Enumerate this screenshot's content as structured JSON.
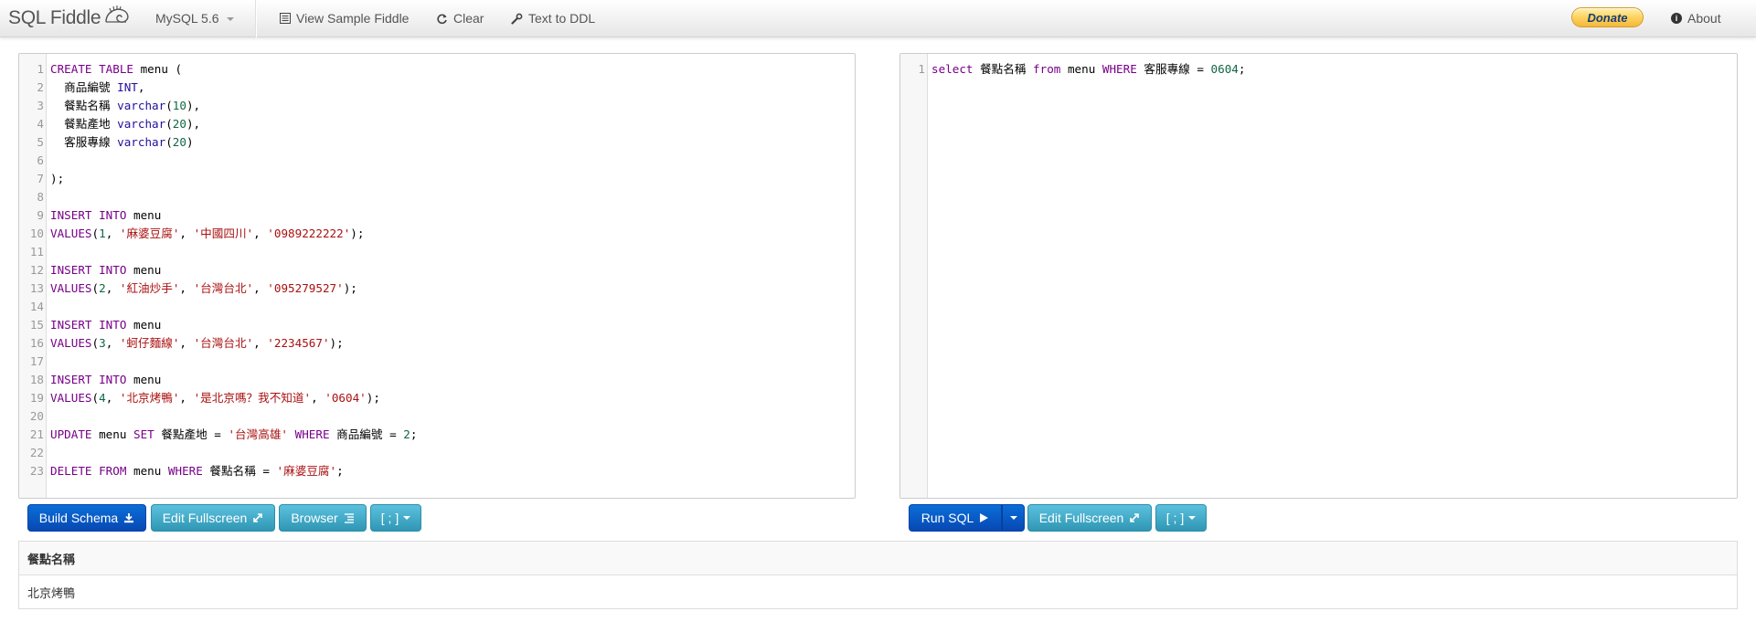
{
  "navbar": {
    "brand": "SQL Fiddle",
    "db_version": "MySQL 5.6",
    "view_sample": "View Sample Fiddle",
    "clear": "Clear",
    "text_to_ddl": "Text to DDL",
    "donate": "Donate",
    "about": "About"
  },
  "schema_editor": {
    "lines": [
      {
        "n": "1",
        "tokens": [
          {
            "t": "CREATE TABLE",
            "c": "kw"
          },
          {
            "t": " menu (",
            "c": ""
          }
        ]
      },
      {
        "n": "2",
        "tokens": [
          {
            "t": "  商品編號 ",
            "c": ""
          },
          {
            "t": "INT",
            "c": "ty"
          },
          {
            "t": ",",
            "c": ""
          }
        ]
      },
      {
        "n": "3",
        "tokens": [
          {
            "t": "  餐點名稱 ",
            "c": ""
          },
          {
            "t": "varchar",
            "c": "ty"
          },
          {
            "t": "(",
            "c": ""
          },
          {
            "t": "10",
            "c": "num"
          },
          {
            "t": "),",
            "c": ""
          }
        ]
      },
      {
        "n": "4",
        "tokens": [
          {
            "t": "  餐點產地 ",
            "c": ""
          },
          {
            "t": "varchar",
            "c": "ty"
          },
          {
            "t": "(",
            "c": ""
          },
          {
            "t": "20",
            "c": "num"
          },
          {
            "t": "),",
            "c": ""
          }
        ]
      },
      {
        "n": "5",
        "tokens": [
          {
            "t": "  客服專線 ",
            "c": ""
          },
          {
            "t": "varchar",
            "c": "ty"
          },
          {
            "t": "(",
            "c": ""
          },
          {
            "t": "20",
            "c": "num"
          },
          {
            "t": ")",
            "c": ""
          }
        ]
      },
      {
        "n": "6",
        "tokens": []
      },
      {
        "n": "7",
        "tokens": [
          {
            "t": ");",
            "c": ""
          }
        ]
      },
      {
        "n": "8",
        "tokens": []
      },
      {
        "n": "9",
        "tokens": [
          {
            "t": "INSERT INTO",
            "c": "kw"
          },
          {
            "t": " menu",
            "c": ""
          }
        ]
      },
      {
        "n": "10",
        "tokens": [
          {
            "t": "VALUES",
            "c": "kw"
          },
          {
            "t": "(",
            "c": ""
          },
          {
            "t": "1",
            "c": "num"
          },
          {
            "t": ", ",
            "c": ""
          },
          {
            "t": "'麻婆豆腐'",
            "c": "str"
          },
          {
            "t": ", ",
            "c": ""
          },
          {
            "t": "'中國四川'",
            "c": "str"
          },
          {
            "t": ", ",
            "c": ""
          },
          {
            "t": "'0989222222'",
            "c": "str"
          },
          {
            "t": ");",
            "c": ""
          }
        ]
      },
      {
        "n": "11",
        "tokens": []
      },
      {
        "n": "12",
        "tokens": [
          {
            "t": "INSERT INTO",
            "c": "kw"
          },
          {
            "t": " menu",
            "c": ""
          }
        ]
      },
      {
        "n": "13",
        "tokens": [
          {
            "t": "VALUES",
            "c": "kw"
          },
          {
            "t": "(",
            "c": ""
          },
          {
            "t": "2",
            "c": "num"
          },
          {
            "t": ", ",
            "c": ""
          },
          {
            "t": "'紅油炒手'",
            "c": "str"
          },
          {
            "t": ", ",
            "c": ""
          },
          {
            "t": "'台灣台北'",
            "c": "str"
          },
          {
            "t": ", ",
            "c": ""
          },
          {
            "t": "'095279527'",
            "c": "str"
          },
          {
            "t": ");",
            "c": ""
          }
        ]
      },
      {
        "n": "14",
        "tokens": []
      },
      {
        "n": "15",
        "tokens": [
          {
            "t": "INSERT INTO",
            "c": "kw"
          },
          {
            "t": " menu",
            "c": ""
          }
        ]
      },
      {
        "n": "16",
        "tokens": [
          {
            "t": "VALUES",
            "c": "kw"
          },
          {
            "t": "(",
            "c": ""
          },
          {
            "t": "3",
            "c": "num"
          },
          {
            "t": ", ",
            "c": ""
          },
          {
            "t": "'蚵仔麵線'",
            "c": "str"
          },
          {
            "t": ", ",
            "c": ""
          },
          {
            "t": "'台灣台北'",
            "c": "str"
          },
          {
            "t": ", ",
            "c": ""
          },
          {
            "t": "'2234567'",
            "c": "str"
          },
          {
            "t": ");",
            "c": ""
          }
        ]
      },
      {
        "n": "17",
        "tokens": []
      },
      {
        "n": "18",
        "tokens": [
          {
            "t": "INSERT INTO",
            "c": "kw"
          },
          {
            "t": " menu",
            "c": ""
          }
        ]
      },
      {
        "n": "19",
        "tokens": [
          {
            "t": "VALUES",
            "c": "kw"
          },
          {
            "t": "(",
            "c": ""
          },
          {
            "t": "4",
            "c": "num"
          },
          {
            "t": ", ",
            "c": ""
          },
          {
            "t": "'北京烤鴨'",
            "c": "str"
          },
          {
            "t": ", ",
            "c": ""
          },
          {
            "t": "'是北京嗎？我不知道'",
            "c": "str"
          },
          {
            "t": ", ",
            "c": ""
          },
          {
            "t": "'0604'",
            "c": "str"
          },
          {
            "t": ");",
            "c": ""
          }
        ]
      },
      {
        "n": "20",
        "tokens": []
      },
      {
        "n": "21",
        "tokens": [
          {
            "t": "UPDATE",
            "c": "kw"
          },
          {
            "t": " menu ",
            "c": ""
          },
          {
            "t": "SET",
            "c": "kw"
          },
          {
            "t": " 餐點產地 = ",
            "c": ""
          },
          {
            "t": "'台灣高雄'",
            "c": "str"
          },
          {
            "t": " ",
            "c": ""
          },
          {
            "t": "WHERE",
            "c": "kw"
          },
          {
            "t": " 商品編號 = ",
            "c": ""
          },
          {
            "t": "2",
            "c": "num"
          },
          {
            "t": ";",
            "c": ""
          }
        ]
      },
      {
        "n": "22",
        "tokens": []
      },
      {
        "n": "23",
        "tokens": [
          {
            "t": "DELETE FROM",
            "c": "kw"
          },
          {
            "t": " menu ",
            "c": ""
          },
          {
            "t": "WHERE",
            "c": "kw"
          },
          {
            "t": " 餐點名稱 = ",
            "c": ""
          },
          {
            "t": "'麻婆豆腐'",
            "c": "str"
          },
          {
            "t": ";",
            "c": ""
          }
        ]
      }
    ]
  },
  "query_editor": {
    "lines": [
      {
        "n": "1",
        "tokens": [
          {
            "t": "select",
            "c": "kw"
          },
          {
            "t": " 餐點名稱 ",
            "c": ""
          },
          {
            "t": "from",
            "c": "kw"
          },
          {
            "t": " menu ",
            "c": ""
          },
          {
            "t": "WHERE",
            "c": "kw"
          },
          {
            "t": " 客服專線 = ",
            "c": ""
          },
          {
            "t": "0604",
            "c": "num"
          },
          {
            "t": ";",
            "c": ""
          }
        ]
      }
    ]
  },
  "schema_buttons": {
    "build_schema": "Build Schema",
    "edit_fullscreen": "Edit Fullscreen",
    "browser": "Browser",
    "terminator": "[ ; ]"
  },
  "query_buttons": {
    "run_sql": "Run SQL",
    "edit_fullscreen": "Edit Fullscreen",
    "terminator": "[ ; ]"
  },
  "results": {
    "columns": [
      "餐點名稱"
    ],
    "rows": [
      [
        "北京烤鴨"
      ]
    ]
  },
  "colors": {
    "keyword": "#770088",
    "type": "#221199",
    "number": "#116644",
    "string": "#aa1111",
    "primary_button": "#0a5fd0",
    "info_button": "#49afcd"
  }
}
